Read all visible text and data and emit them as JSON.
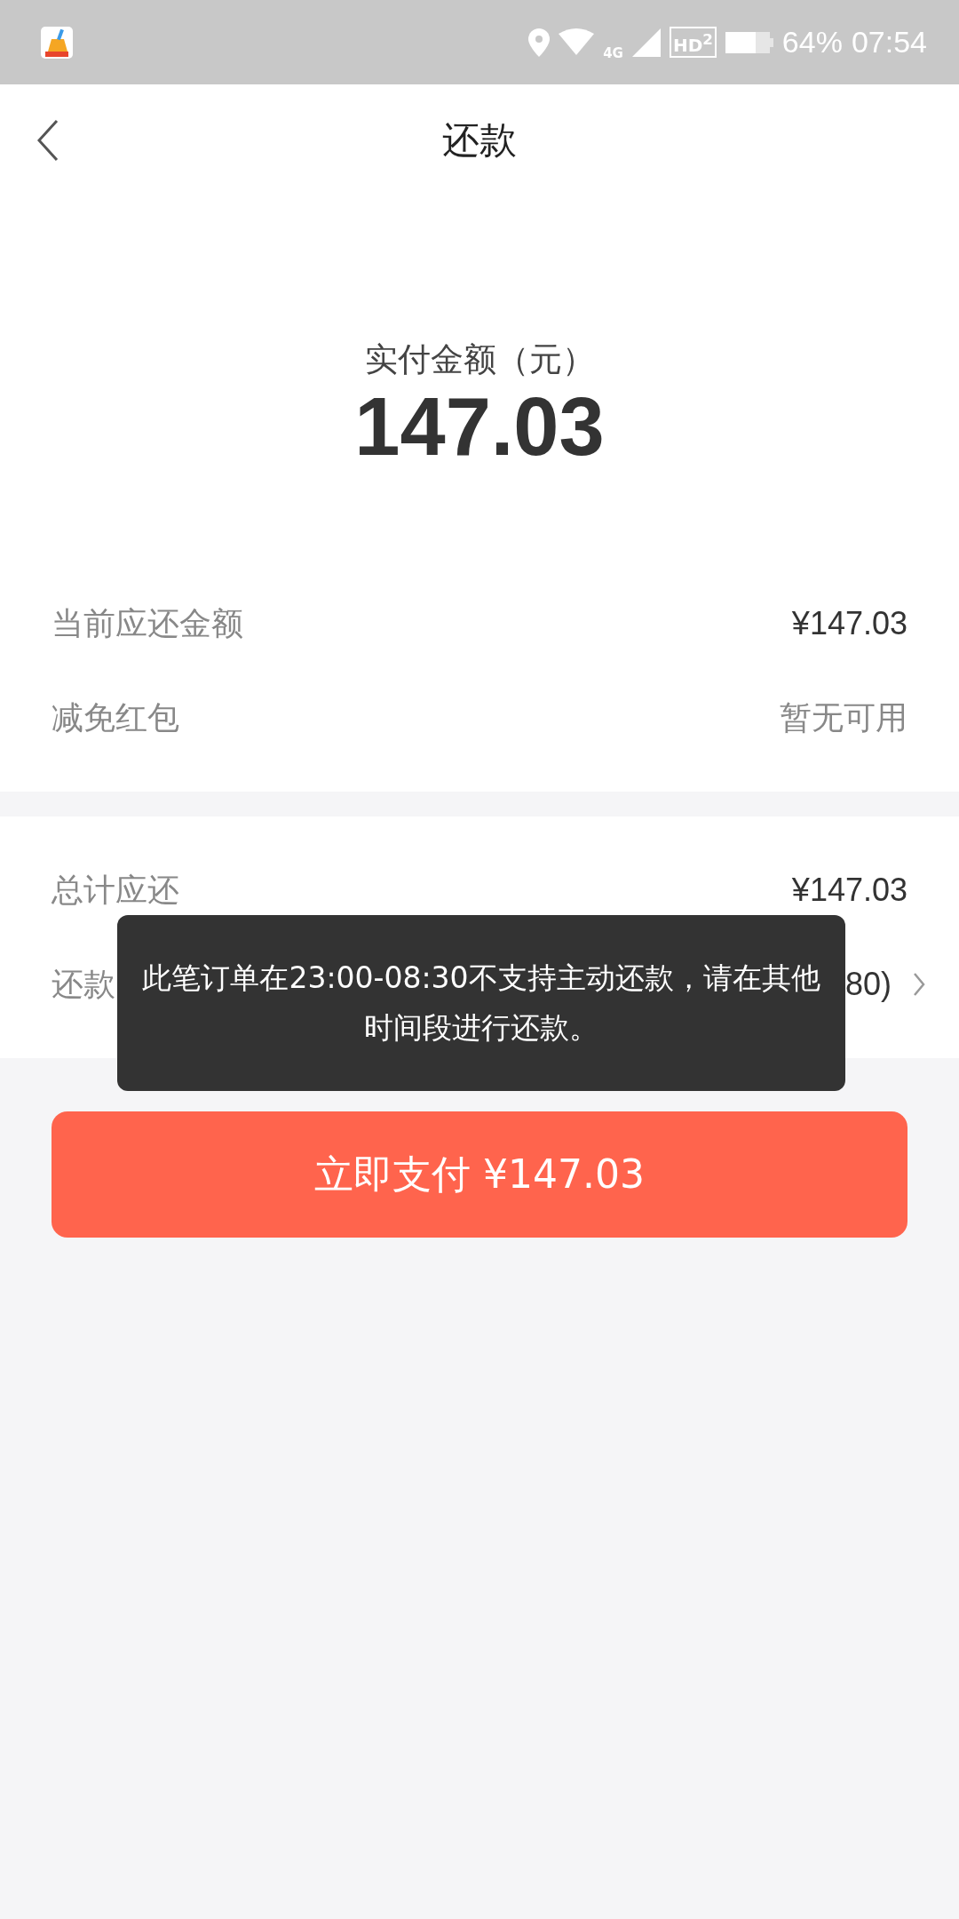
{
  "status_bar": {
    "network": "4G",
    "hd": "HD$^{2}$",
    "battery_text": "64%",
    "time": "07:54"
  },
  "header": {
    "title": "还款"
  },
  "amount": {
    "label": "实付金额（元）",
    "value": "147.03"
  },
  "sections": [
    {
      "rows": [
        {
          "label": "当前应还金额",
          "value": "¥147.03",
          "muted": false,
          "chevron": false
        },
        {
          "label": "减免红包",
          "value": "暂无可用",
          "muted": true,
          "chevron": false
        }
      ]
    },
    {
      "rows": [
        {
          "label": "总计应还",
          "value": "¥147.03",
          "muted": false,
          "chevron": false
        },
        {
          "label": "还款",
          "value": "80)",
          "muted": false,
          "chevron": true
        }
      ]
    }
  ],
  "pay_button": {
    "label": "立即支付 ¥147.03"
  },
  "toast": {
    "message": "此笔订单在23:00-08:30不支持主动还款，请在其他时间段进行还款。"
  }
}
